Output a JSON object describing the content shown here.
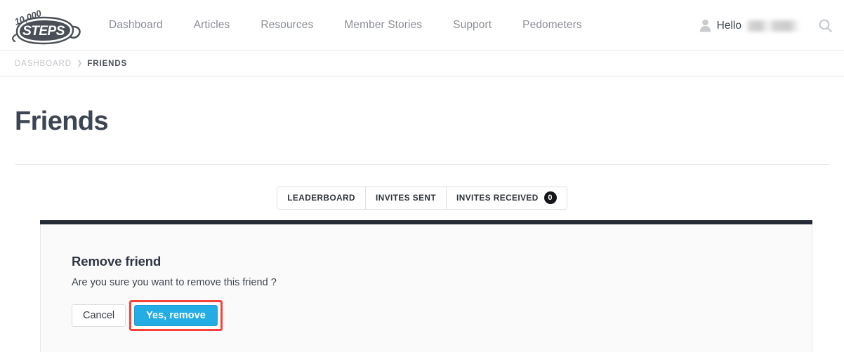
{
  "header": {
    "logo": {
      "icon": "footprint-logo-icon",
      "top_text": "10,000",
      "main_text": "STEPS"
    },
    "nav": [
      {
        "label": "Dashboard"
      },
      {
        "label": "Articles"
      },
      {
        "label": "Resources"
      },
      {
        "label": "Member Stories"
      },
      {
        "label": "Support"
      },
      {
        "label": "Pedometers"
      }
    ],
    "account": {
      "user_icon": "user-silhouette-icon",
      "greeting": "Hello",
      "username": "",
      "username_redacted": true
    },
    "search": {
      "icon": "search-icon",
      "label": "Search"
    }
  },
  "breadcrumb": {
    "items": [
      {
        "label": "DASHBOARD",
        "current": false
      },
      {
        "label": "FRIENDS",
        "current": true
      }
    ],
    "separator": "❯"
  },
  "page": {
    "title": "Friends"
  },
  "tabs": [
    {
      "label": "LEADERBOARD",
      "badge": null
    },
    {
      "label": "INVITES SENT",
      "badge": null
    },
    {
      "label": "INVITES RECEIVED",
      "badge": "0"
    }
  ],
  "panel": {
    "heading": "Remove friend",
    "message": "Are you sure you want to remove this friend ?",
    "cancel_label": "Cancel",
    "confirm_label": "Yes, remove"
  },
  "colors": {
    "accent_blue": "#24ace4",
    "panel_topbar": "#242b36",
    "highlight_red": "#f9423a",
    "badge_black": "#14161a",
    "title_slate": "#3d4453",
    "nav_gray": "#8b8f96"
  }
}
